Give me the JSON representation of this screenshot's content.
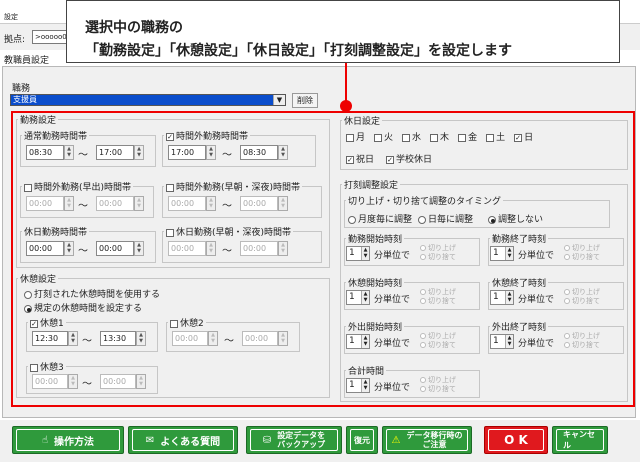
{
  "window": {
    "title": "設定",
    "base_label": "拠点:",
    "base_value": ">ooooo00"
  },
  "tab": {
    "label": "教職員設定"
  },
  "job": {
    "label": "職務",
    "value": "支援員",
    "delete": "削除"
  },
  "callout": {
    "line1": "選択中の職務の",
    "line2": "「勤務設定」「休憩設定」「休日設定」「打刻調整設定」を設定します"
  },
  "work": {
    "title": "勤務設定",
    "normal": {
      "label": "通常勤務時間帯",
      "from": "08:30",
      "to": "17:00"
    },
    "overtime": {
      "label": "時間外勤務時間帯",
      "checked": true,
      "from": "17:00",
      "to": "08:30"
    },
    "early": {
      "label": "時間外勤務(早出)時間帯",
      "from": "00:00",
      "to": "00:00"
    },
    "late": {
      "label": "時間外勤務(早朝・深夜)時間帯",
      "from": "00:00",
      "to": "00:00"
    },
    "holiday": {
      "label": "休日勤務時間帯",
      "from": "00:00",
      "to": "00:00"
    },
    "holiday_late": {
      "label": "休日勤務(早朝・深夜)時間帯",
      "from": "00:00",
      "to": "00:00"
    },
    "tilde": "～"
  },
  "rest": {
    "title": "休憩設定",
    "opt1": "打刻された休憩時間を使用する",
    "opt2": "規定の休憩時間を設定する",
    "b1": {
      "label": "休憩1",
      "from": "12:30",
      "to": "13:30"
    },
    "b2": {
      "label": "休憩2",
      "from": "00:00",
      "to": "00:00"
    },
    "b3": {
      "label": "休憩3",
      "from": "00:00",
      "to": "00:00"
    }
  },
  "holiday": {
    "title": "休日設定",
    "days": [
      "月",
      "火",
      "水",
      "木",
      "金",
      "土",
      "日"
    ],
    "checked": [
      "日"
    ],
    "extra1": "祝日",
    "extra2": "学校休日"
  },
  "adjust": {
    "title": "打刻調整設定",
    "timing_title": "切り上げ・切り捨て調整のタイミング",
    "timing_opts": [
      "月度毎に調整",
      "日毎に調整",
      "調整しない"
    ],
    "unit": "分単位で",
    "round_up": "切り上げ",
    "round_down": "切り捨て",
    "boxes": [
      {
        "label": "勤務開始時刻",
        "value": "1"
      },
      {
        "label": "勤務終了時刻",
        "value": "1"
      },
      {
        "label": "休憩開始時刻",
        "value": "1"
      },
      {
        "label": "休憩終了時刻",
        "value": "1"
      },
      {
        "label": "外出開始時刻",
        "value": "1"
      },
      {
        "label": "外出終了時刻",
        "value": "1"
      },
      {
        "label": "合計時間",
        "value": "1"
      }
    ]
  },
  "footer": {
    "manual": "操作方法",
    "faq": "よくある質問",
    "backup": "設定データを\nバックアップ",
    "restore": "復元",
    "migrate": "データ移行時の\nご注意",
    "ok": "O K",
    "cancel": "キャンセル"
  }
}
